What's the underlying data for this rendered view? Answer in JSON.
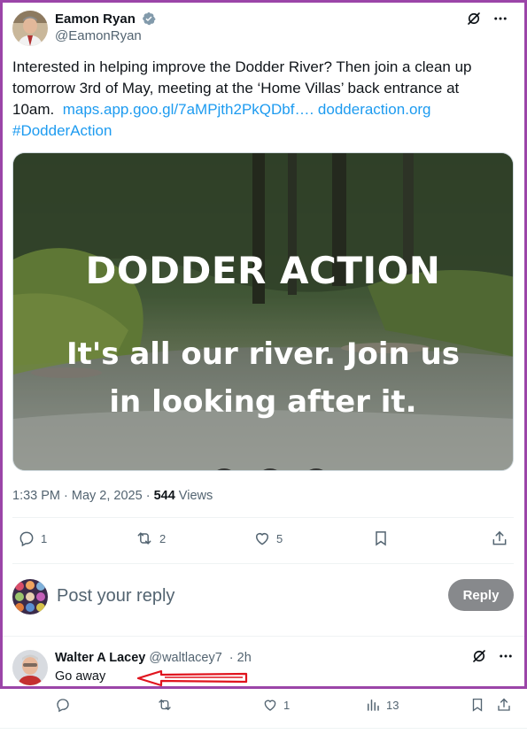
{
  "tweet": {
    "author_name": "Eamon Ryan",
    "author_handle": "@EamonRyan",
    "text_main": "Interested in helping improve the Dodder River? Then join a clean up tomorrow 3rd of May, meeting at the ‘Home Villas’ back entrance at 10am.",
    "link1": "maps.app.goo.gl/7aMPjth2PkQDbf….",
    "link2": "dodderaction.org",
    "hashtag": "#DodderAction",
    "media": {
      "title": "DODDER ACTION",
      "subtitle": "It's all our river. Join us in looking after it."
    },
    "timestamp": "1:33 PM · May 2, 2025",
    "meta_sep": " · ",
    "views_count": "544",
    "views_label": " Views",
    "actions": {
      "replies": "1",
      "reposts": "2",
      "likes": "5"
    }
  },
  "reply_composer": {
    "placeholder": "Post your reply",
    "button_label": "Reply"
  },
  "reply": {
    "name": "Walter A Lacey",
    "handle": "@waltlacey7",
    "time": "· 2h",
    "text": "Go away",
    "actions": {
      "replies": "",
      "reposts": "",
      "likes": "1",
      "views": "13"
    }
  },
  "colors": {
    "frame": "#9b45a8",
    "link": "#1d9bf0",
    "verified": "#829aab",
    "annotation_arrow": "#e0141e"
  },
  "icons": [
    "grok-icon",
    "more-icon",
    "verified-icon",
    "reply-icon",
    "repost-icon",
    "like-icon",
    "bookmark-icon",
    "share-icon",
    "views-icon"
  ]
}
